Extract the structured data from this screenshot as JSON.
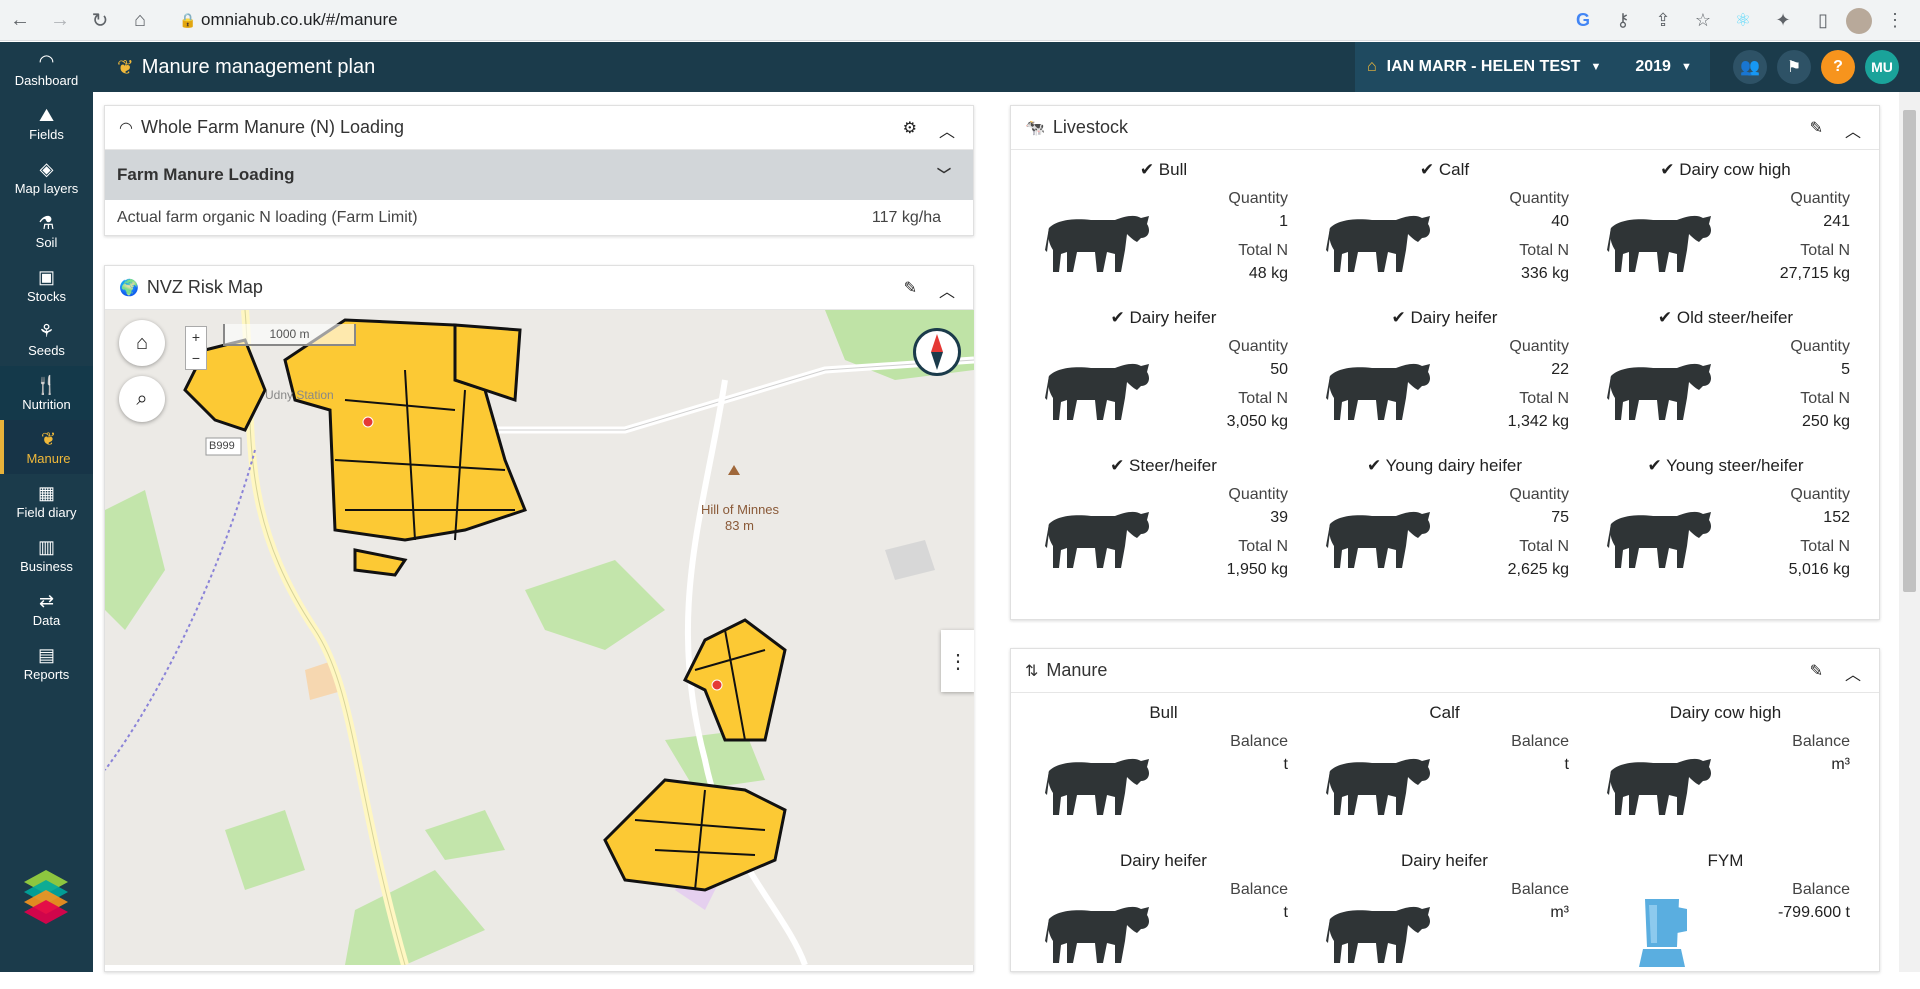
{
  "browser": {
    "url": "omniahub.co.uk/#/manure"
  },
  "sidebar": {
    "items": [
      {
        "label": "Dashboard",
        "icon": "gauge-icon"
      },
      {
        "label": "Fields",
        "icon": "fields-icon"
      },
      {
        "label": "Map layers",
        "icon": "layers-icon"
      },
      {
        "label": "Soil",
        "icon": "flask-icon"
      },
      {
        "label": "Stocks",
        "icon": "stocks-icon"
      },
      {
        "label": "Seeds",
        "icon": "seedling-icon"
      },
      {
        "label": "Nutrition",
        "icon": "cutlery-icon"
      },
      {
        "label": "Manure",
        "icon": "sprout-icon"
      },
      {
        "label": "Field diary",
        "icon": "calendar-icon"
      },
      {
        "label": "Business",
        "icon": "chart-icon"
      },
      {
        "label": "Data",
        "icon": "arrows-icon"
      },
      {
        "label": "Reports",
        "icon": "reports-icon"
      }
    ],
    "active": "Manure"
  },
  "header": {
    "title": "Manure management plan",
    "farm": "IAN MARR - HELEN TEST",
    "year": "2019",
    "user_initials": "MU"
  },
  "loading": {
    "title": "Whole Farm Manure (N) Loading",
    "section": "Farm Manure Loading",
    "row_label": "Actual farm organic N loading (Farm Limit)",
    "row_value": "117 kg/ha"
  },
  "nvz": {
    "title": "NVZ Risk Map",
    "scale": "1000 m",
    "labels": {
      "road": "B999",
      "hill": "Hill of Minnes",
      "hill_height": "83 m",
      "station": "Udny Station"
    }
  },
  "livestock": {
    "title": "Livestock",
    "items": [
      {
        "name": "Bull",
        "quantity_label": "Quantity",
        "quantity": "1",
        "n_label": "Total N",
        "n": "48 kg"
      },
      {
        "name": "Calf",
        "quantity_label": "Quantity",
        "quantity": "40",
        "n_label": "Total N",
        "n": "336 kg"
      },
      {
        "name": "Dairy cow high",
        "quantity_label": "Quantity",
        "quantity": "241",
        "n_label": "Total N",
        "n": "27,715 kg"
      },
      {
        "name": "Dairy heifer",
        "quantity_label": "Quantity",
        "quantity": "50",
        "n_label": "Total N",
        "n": "3,050 kg"
      },
      {
        "name": "Dairy heifer",
        "quantity_label": "Quantity",
        "quantity": "22",
        "n_label": "Total N",
        "n": "1,342 kg"
      },
      {
        "name": "Old steer/heifer",
        "quantity_label": "Quantity",
        "quantity": "5",
        "n_label": "Total N",
        "n": "250 kg"
      },
      {
        "name": "Steer/heifer",
        "quantity_label": "Quantity",
        "quantity": "39",
        "n_label": "Total N",
        "n": "1,950 kg"
      },
      {
        "name": "Young dairy heifer",
        "quantity_label": "Quantity",
        "quantity": "75",
        "n_label": "Total N",
        "n": "2,625 kg"
      },
      {
        "name": "Young steer/heifer",
        "quantity_label": "Quantity",
        "quantity": "152",
        "n_label": "Total N",
        "n": "5,016 kg"
      }
    ]
  },
  "manure": {
    "title": "Manure",
    "items": [
      {
        "name": "Bull",
        "balance_label": "Balance",
        "balance": "t",
        "icon": "cow-icon"
      },
      {
        "name": "Calf",
        "balance_label": "Balance",
        "balance": "t",
        "icon": "cow-icon"
      },
      {
        "name": "Dairy cow high",
        "balance_label": "Balance",
        "balance": "m³",
        "icon": "cow-icon"
      },
      {
        "name": "Dairy heifer",
        "balance_label": "Balance",
        "balance": "t",
        "icon": "cow-icon"
      },
      {
        "name": "Dairy heifer",
        "balance_label": "Balance",
        "balance": "m³",
        "icon": "cow-icon"
      },
      {
        "name": "FYM",
        "balance_label": "Balance",
        "balance": "-799.600 t",
        "icon": "blender-icon"
      }
    ]
  },
  "colors": {
    "sidebar": "#1b3b4b",
    "accent": "#f0b93a",
    "field_fill": "#fcc934",
    "help": "#f7941d",
    "avatar": "#1aa39a"
  }
}
